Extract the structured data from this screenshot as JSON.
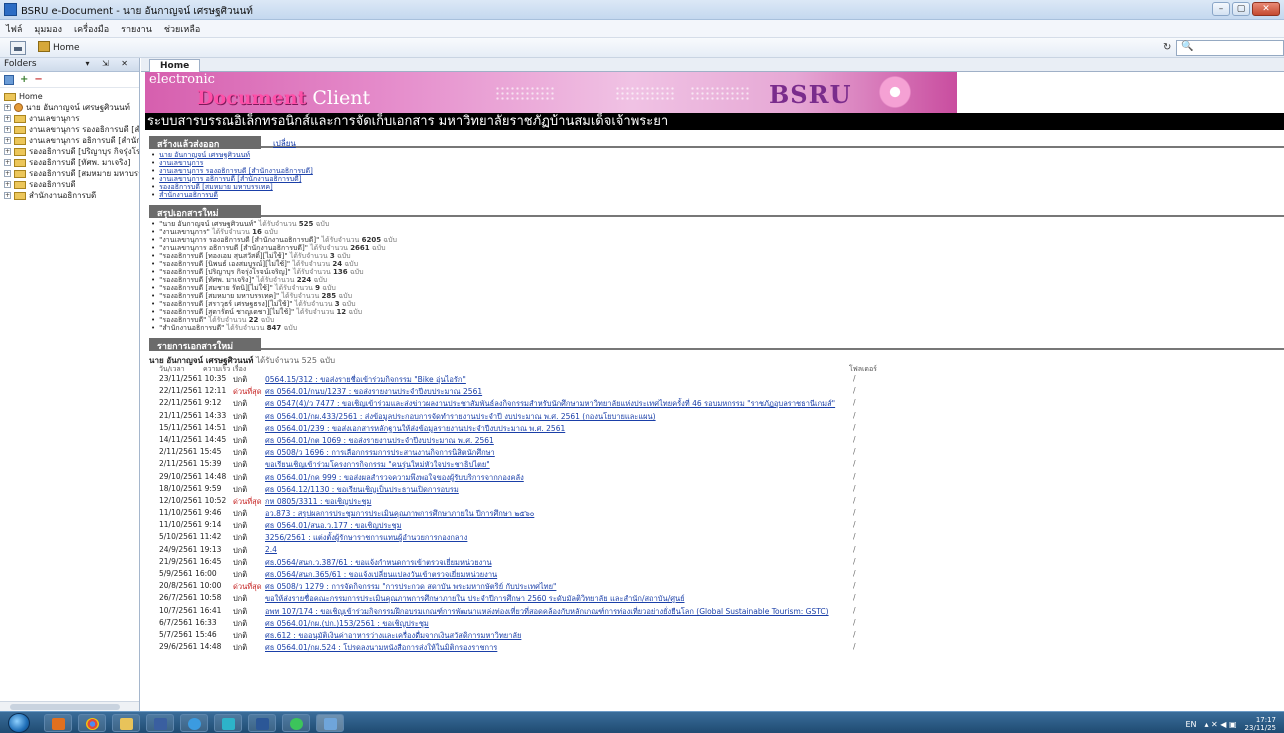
{
  "window": {
    "title": "BSRU e-Document - นาย อันกาญจน์ เศรษฐศิวนนท์",
    "controls": [
      "–",
      "▢",
      "✕"
    ]
  },
  "menu": [
    "ไฟล์",
    "มุมมอง",
    "เครื่องมือ",
    "รายงาน",
    "ช่วยเหลือ"
  ],
  "toolbar": {
    "home_label": "Home",
    "reload_icon": "↻",
    "search_icon": "🔍"
  },
  "sidebar": {
    "title": "Folders",
    "controls": "▾ ⇲ ✕",
    "tools": {
      "add": "+",
      "remove": "−"
    },
    "home_label": "Home",
    "items": [
      "นาย อันกาญจน์ เศรษฐศิวนนท์",
      "งานเลขานุการ",
      "งานเลขานุการ รองอธิการบดี [สำนักงานอธิการบดี]",
      "งานเลขานุการ อธิการบดี [สำนักงานอธิการบดี]",
      "รองอธิการบดี [ปริญาบุร กิจรุ่งโรจน์เจริญ]",
      "รองอธิการบดี [ทัศพ. มาเจริง]",
      "รองอธิการบดี [สมหมาย มหาบรรเทค]",
      "รองอธิการบดี",
      "สำนักงานอธิการบดี"
    ],
    "scroll_label": "III"
  },
  "tab": {
    "label": "Home"
  },
  "banner": {
    "line1": "electronic",
    "line2_highlight": "Document",
    "line2_rest": " Client",
    "logo_text": "BSRU"
  },
  "system_title": "ระบบสารบรรณอิเล็กทรอนิกส์และการจัดเก็บเอกสาร มหาวิทยาลัยราชภัฏบ้านสมเด็จเจ้าพระยา",
  "sent_section": {
    "title": "สร้างแล้วส่งออก",
    "change_link": "เปลี่ยน",
    "links": [
      "นาย อันกาญจน์ เศรษฐศิวนนท์",
      "งานเลขานุการ",
      "งานเลขานุการ รองอธิการบดี [สำนักงานอธิการบดี]",
      "งานเลขานุการ อธิการบดี [สำนักงานอธิการบดี]",
      "รองอธิการบดี [สมหมาย มหาบรรเทค]",
      "สำนักงานอธิการบดี"
    ]
  },
  "summary_section": {
    "title": "สรุปเอกสารใหม่",
    "received_label": "ได้รับจำนวน",
    "unit_label": "ฉบับ",
    "items": [
      {
        "name": "นาย อันกาญจน์ เศรษฐศิวนนท์",
        "count": "525"
      },
      {
        "name": "งานเลขานุการ",
        "count": "16"
      },
      {
        "name": "งานเลขานุการ รองอธิการบดี [สำนักงานอธิการบดี]",
        "count": "6205"
      },
      {
        "name": "งานเลขานุการ อธิการบดี [สำนักงานอธิการบดี]",
        "count": "2661"
      },
      {
        "name": "รองอธิการบดี [ทองเอม สุนสวัสดิ์][ไม่ใช้]",
        "count": "3"
      },
      {
        "name": "รองอธิการบดี [นิพนธ์ เองสมบูรณ์][ไม่ใช้]",
        "count": "24"
      },
      {
        "name": "รองอธิการบดี [ปริญาบุร กิจรุ่งโรจน์เจริญ]",
        "count": "136"
      },
      {
        "name": "รองอธิการบดี [ทัศพ. มาเจริง]",
        "count": "224"
      },
      {
        "name": "รองอธิการบดี [สมชาย รัตนิ][ไม่ใช้]",
        "count": "9"
      },
      {
        "name": "รองอธิการบดี [สมหมาย มหาบรรเทค]",
        "count": "285"
      },
      {
        "name": "รองอธิการบดี [สราวุธร์ เศรษฐธรง][ไม่ใช้]",
        "count": "3"
      },
      {
        "name": "รองอธิการบดี [สุดารัตน์ ชาญเดชา][ไม่ใช้]",
        "count": "12"
      },
      {
        "name": "รองอธิการบดี",
        "count": "22"
      },
      {
        "name": "สำนักงานอธิการบดี",
        "count": "847"
      }
    ]
  },
  "docs_section": {
    "title": "รายการเอกสารใหม่",
    "owner": "นาย อันกาญจน์ เศรษฐศิวนนท์",
    "owner_count": "ได้รับจำนวน 525 ฉบับ",
    "col_date": "วัน/เวลา",
    "col_subject": "ความเร็ว เรื่อง",
    "col_folder": "โฟลเดอร์",
    "rows": [
      {
        "date": "23/11/2561 10:35",
        "priority": "ปกติ",
        "urgent": false,
        "subject": "0564.15/312 : ขอส่งรายชื่อเข้าร่วมกิจกรรม \"Bike อุ่นไอรัก\"",
        "folder": "/"
      },
      {
        "date": "22/11/2561 12:11",
        "priority": "ด่วนที่สุด",
        "urgent": true,
        "subject": "ศธ 0564.01/กนบ/1237 : ขอส่งรายงานประจำปีงบประมาณ 2561",
        "folder": "/"
      },
      {
        "date": "22/11/2561 9:12",
        "priority": "ปกติ",
        "urgent": false,
        "subject": "ศธ 0547(4)/ว 7477 : ขอเชิญเข้าร่วมและส่งข่าวผลงานประชาสัมพันธ์ลงกิจกรรมสำหรับนักศึกษามหาวิทยาลัยแห่งประเทศไทยครั้งที่ 46 รอบมหกรรม \"ราชภัฏอุบลราชธานีเกมส์\"",
        "folder": "/"
      },
      {
        "date": "21/11/2561 14:33",
        "priority": "ปกติ",
        "urgent": false,
        "subject": "ศธ 0564.01/กผ.433/2561 : ส่งข้อมูลประกอบการจัดทำรายงานประจำปี งบประมาณ พ.ศ. 2561 (กองนโยบายและแผน)",
        "folder": "/"
      },
      {
        "date": "15/11/2561 14:51",
        "priority": "ปกติ",
        "urgent": false,
        "subject": "ศธ 0564.01/239 : ขอส่งเอกสารหลักฐานให้ส่งข้อมูลรายงานประจำปีงบประมาณ พ.ศ. 2561",
        "folder": "/"
      },
      {
        "date": "14/11/2561 14:45",
        "priority": "ปกติ",
        "urgent": false,
        "subject": "ศธ 0564.01/กต 1069 : ขอส่งรายงานประจำปีงบประมาณ พ.ศ. 2561",
        "folder": "/"
      },
      {
        "date": "2/11/2561 15:45",
        "priority": "ปกติ",
        "urgent": false,
        "subject": "ศธ 0508/ว 1696 : การเลือกกรรมการประสานงานกิจการนิสิตนักศึกษา",
        "folder": "/"
      },
      {
        "date": "2/11/2561 15:39",
        "priority": "ปกติ",
        "urgent": false,
        "subject": "ขอเรียนเชิญเข้าร่วมโครงการกิจกรรม \"คนรุ่นใหม่หัวใจประชาธิปไตย\"",
        "folder": "/"
      },
      {
        "date": "29/10/2561 14:48",
        "priority": "ปกติ",
        "urgent": false,
        "subject": "ศธ 0564.01/กค 999 : ขอส่งผลสำรวจความพึงพอใจของผู้รับบริการจากกองคลัง",
        "folder": "/"
      },
      {
        "date": "18/10/2561 9:59",
        "priority": "ปกติ",
        "urgent": false,
        "subject": "ศธ 0564.12/1130 : ขอเรียนเชิญเป็นประธานเปิดการอบรม",
        "folder": "/"
      },
      {
        "date": "12/10/2561 10:52",
        "priority": "ด่วนที่สุด",
        "urgent": true,
        "subject": "กห 0805/3311 : ขอเชิญประชุม",
        "folder": "/"
      },
      {
        "date": "11/10/2561 9:46",
        "priority": "ปกติ",
        "urgent": false,
        "subject": "อว.873 : สรุปผลการประชุมการประเมินคุณภาพการศึกษาภายใน ปีการศึกษา ๒๕๖๐",
        "folder": "/"
      },
      {
        "date": "11/10/2561 9:14",
        "priority": "ปกติ",
        "urgent": false,
        "subject": "ศธ 0564.01/สนอ.ว.177 : ขอเชิญประชุม",
        "folder": "/"
      },
      {
        "date": "5/10/2561 11:42",
        "priority": "ปกติ",
        "urgent": false,
        "subject": "3256/2561 : แต่งตั้งผู้รักษาราชการแทนผู้อำนวยการกองกลาง",
        "folder": "/"
      },
      {
        "date": "24/9/2561 19:13",
        "priority": "ปกติ",
        "urgent": false,
        "subject": "2.4",
        "folder": "/"
      },
      {
        "date": "21/9/2561 16:45",
        "priority": "ปกติ",
        "urgent": false,
        "subject": "ศธ.0564/สนก.ว.387/61 : ขอแจ้งกำหนดการเข้าตรวจเยี่ยมหน่วยงาน",
        "folder": "/"
      },
      {
        "date": "5/9/2561 16:00",
        "priority": "ปกติ",
        "urgent": false,
        "subject": "ศธ.0564/สนก.365/61 : ขอแจ้งเปลี่ยนแปลงวันเข้าตรวจเยี่ยมหน่วยงาน",
        "folder": "/"
      },
      {
        "date": "20/8/2561 10:00",
        "priority": "ด่วนที่สุด",
        "urgent": true,
        "subject": "ศธ 0508/ว 1279 : การจัดกิจกรรม \"การประกวด สดาบัน พระมหากษัตริย์ กับประเทศไทย\"",
        "folder": "/"
      },
      {
        "date": "26/7/2561 10:58",
        "priority": "ปกติ",
        "urgent": false,
        "subject": "ขอให้ส่งรายชื่อคณะกรรมการประเมินคุณภาพการศึกษาภายใน ประจำปีการศึกษา 2560 ระดับมัลติวิทยาลัย และสำนัก/สถาบัน/ศูนย์",
        "folder": "/"
      },
      {
        "date": "10/7/2561 16:41",
        "priority": "ปกติ",
        "urgent": false,
        "subject": "อพท 107/174 : ขอเชิญเข้าร่วมกิจกรรมฝึกอบรมเกณฑ์การพัฒนาแหล่งท่องเที่ยวที่สอดคล้องกับหลักเกณฑ์การท่องเที่ยวอย่างยั่งยืนโลก (Global Sustainable Tourism: GSTC)",
        "folder": "/"
      },
      {
        "date": "6/7/2561 16:33",
        "priority": "ปกติ",
        "urgent": false,
        "subject": "ศธ 0564.01/กผ.(ปก.)153/2561 : ขอเชิญประชุม",
        "folder": "/"
      },
      {
        "date": "5/7/2561 15:46",
        "priority": "ปกติ",
        "urgent": false,
        "subject": "ศธ.612 : ขออนุมัติเงินค่าอาหารว่างและเครื่องดื่มจากเงินสวัสดิการมหาวิทยาลัย",
        "folder": "/"
      },
      {
        "date": "29/6/2561 14:48",
        "priority": "ปกติ",
        "urgent": false,
        "subject": "ศธ 0564.01/กผ.524 : โปรดลงนามหนังสือการส่งให้ในมิติกรองราชการ",
        "folder": "/"
      }
    ]
  },
  "taskbar": {
    "lang": "EN",
    "time": "17:17",
    "date": "23/11/25"
  },
  "colors": {
    "banner_pink": "#e58ccb",
    "urgent_red": "#c41e1e",
    "link_blue": "#1a3fa8",
    "section_gray": "#6b6b6b"
  }
}
